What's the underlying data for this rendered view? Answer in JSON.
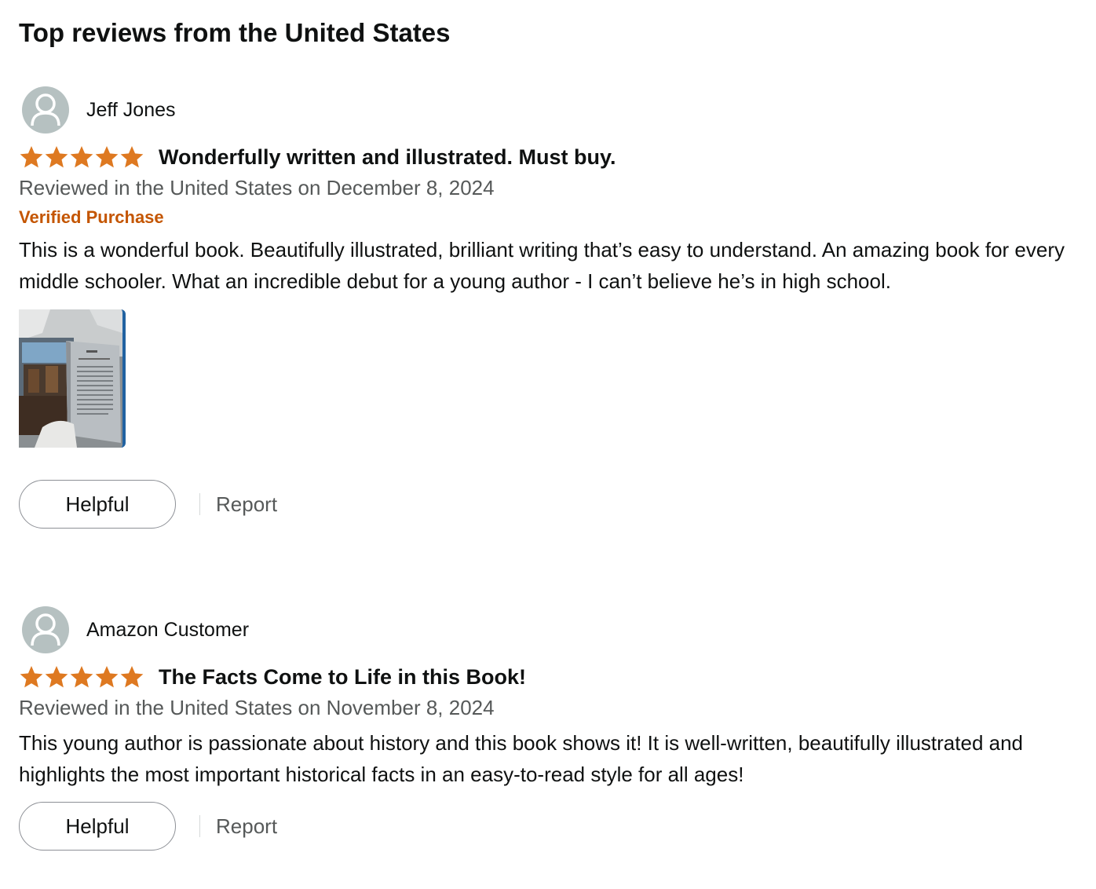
{
  "section": {
    "title": "Top reviews from the United States"
  },
  "reviews": [
    {
      "profile_name": "Jeff Jones",
      "rating": 5,
      "max_rating": 5,
      "title": "Wonderfully written and illustrated. Must buy.",
      "date_text": "Reviewed in the United States on December 8, 2024",
      "badge": "Verified Purchase",
      "body": "This is a wonderful book. Beautifully illustrated, brilliant writing that’s easy to understand. An amazing book for every middle schooler. What an incredible debut for a young author - I can’t believe he’s in high school.",
      "helpful_label": "Helpful",
      "report_label": "Report"
    },
    {
      "profile_name": "Amazon Customer",
      "rating": 5,
      "max_rating": 5,
      "title": "The Facts Come to Life in this Book!",
      "date_text": "Reviewed in the United States on November 8, 2024",
      "body": "This young author is passionate about history and this book shows it! It is well-written, beautifully illustrated and highlights the most important historical facts in an easy-to-read style for all ages!",
      "helpful_label": "Helpful",
      "report_label": "Report"
    }
  ],
  "colors": {
    "star": "#de7921",
    "verified": "#c45500",
    "secondary_text": "#565959",
    "avatar_bg": "#b6c1c1",
    "image_border": "#2162a1"
  },
  "icons": {
    "avatar": "user-silhouette-icon",
    "star": "star-icon"
  }
}
